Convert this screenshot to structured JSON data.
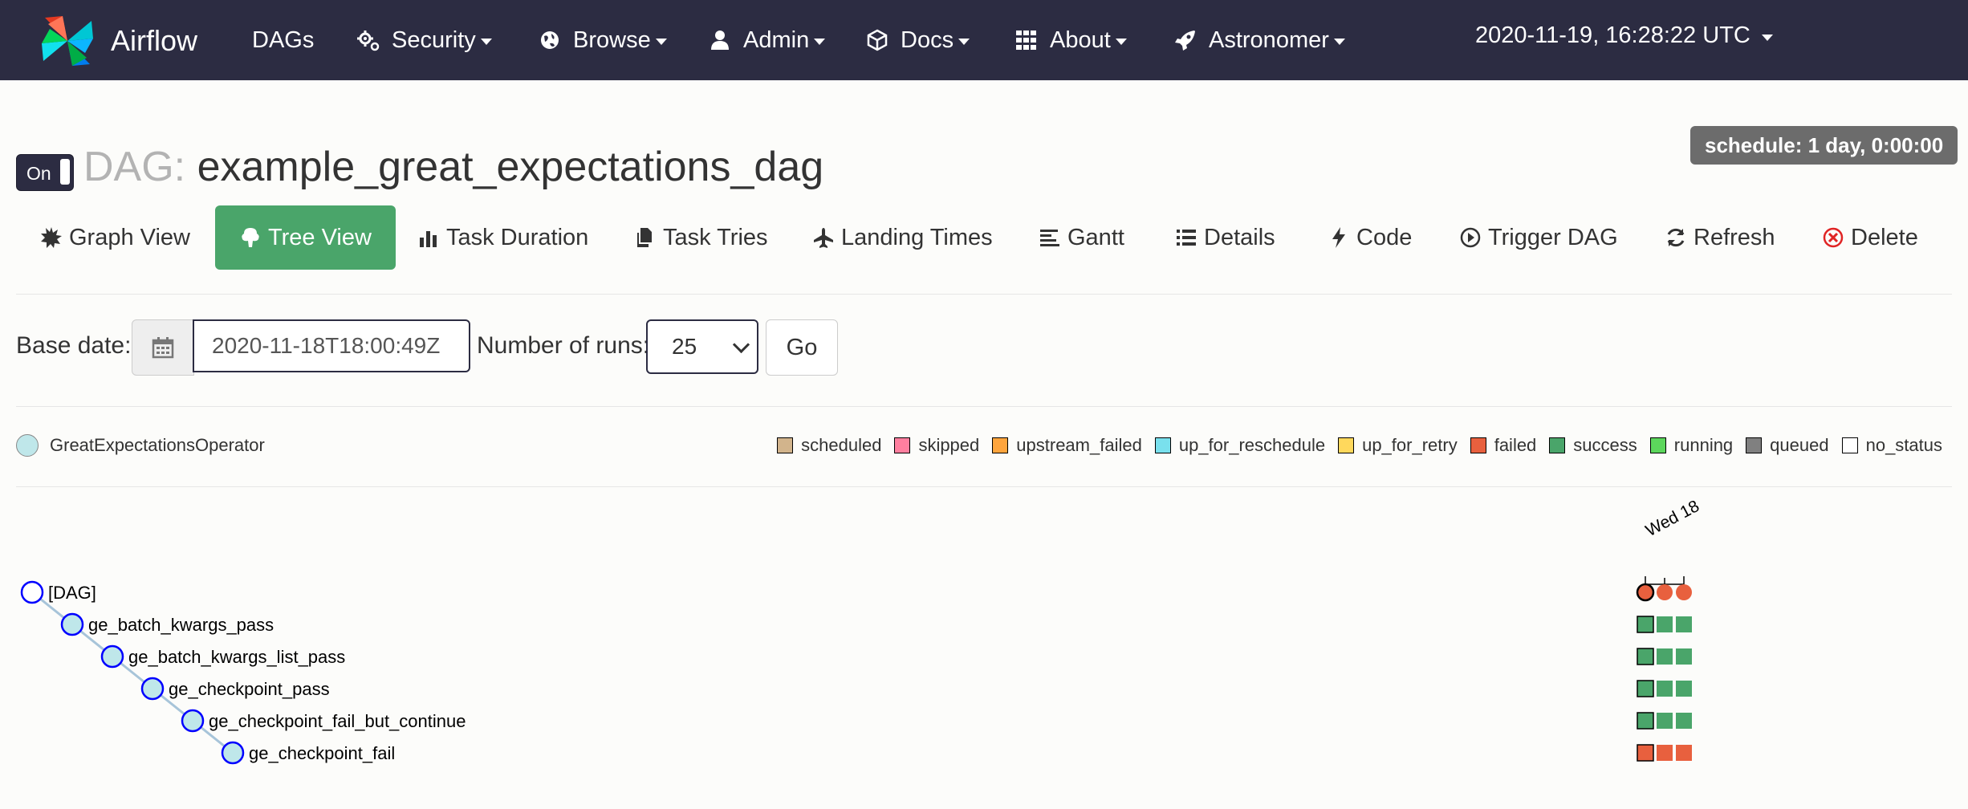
{
  "navbar": {
    "brand": "Airflow",
    "items": [
      {
        "label": "DAGs",
        "icon": ""
      },
      {
        "label": "Security",
        "icon": "gears-icon"
      },
      {
        "label": "Browse",
        "icon": "globe-icon"
      },
      {
        "label": "Admin",
        "icon": "user-icon"
      },
      {
        "label": "Docs",
        "icon": "cube-icon"
      },
      {
        "label": "About",
        "icon": "grid-icon"
      },
      {
        "label": "Astronomer",
        "icon": "rocket-icon"
      }
    ],
    "clock": "2020-11-19, 16:28:22 UTC"
  },
  "dag": {
    "toggle_label": "On",
    "title_prefix": "DAG:",
    "name": "example_great_expectations_dag",
    "schedule": "schedule: 1 day, 0:00:00"
  },
  "tabs": [
    {
      "label": "Graph View",
      "icon": "burst-icon"
    },
    {
      "label": "Tree View",
      "icon": "tree-icon",
      "active": true
    },
    {
      "label": "Task Duration",
      "icon": "bar-chart-icon"
    },
    {
      "label": "Task Tries",
      "icon": "files-icon"
    },
    {
      "label": "Landing Times",
      "icon": "plane-icon"
    },
    {
      "label": "Gantt",
      "icon": "align-left-icon"
    },
    {
      "label": "Details",
      "icon": "list-icon"
    },
    {
      "label": "Code",
      "icon": "bolt-icon"
    },
    {
      "label": "Trigger DAG",
      "icon": "play-circle-icon"
    },
    {
      "label": "Refresh",
      "icon": "refresh-icon"
    },
    {
      "label": "Delete",
      "icon": "times-circle-icon"
    }
  ],
  "filters": {
    "base_date_label": "Base date:",
    "base_date_value": "2020-11-18T18:00:49Z",
    "runs_label": "Number of runs:",
    "runs_value": "25",
    "go_label": "Go"
  },
  "operator_legend": {
    "name": "GreatExpectationsOperator",
    "color": "#bfe7ea"
  },
  "state_legend": [
    {
      "label": "scheduled",
      "color": "#d2b48c"
    },
    {
      "label": "skipped",
      "color": "#ff7f9f"
    },
    {
      "label": "upstream_failed",
      "color": "#ffa53d"
    },
    {
      "label": "up_for_reschedule",
      "color": "#79e0ed"
    },
    {
      "label": "up_for_retry",
      "color": "#ffd85c"
    },
    {
      "label": "failed",
      "color": "#e8603e"
    },
    {
      "label": "success",
      "color": "#4aa56a"
    },
    {
      "label": "running",
      "color": "#5cd65c"
    },
    {
      "label": "queued",
      "color": "#808080"
    },
    {
      "label": "no_status",
      "color": "#ffffff"
    }
  ],
  "tree": {
    "date_header": "Wed 18",
    "nodes": [
      {
        "label": "[DAG]",
        "runs": [
          "failed",
          "failed",
          "failed"
        ]
      },
      {
        "label": "ge_batch_kwargs_pass",
        "runs": [
          "success",
          "success",
          "success"
        ]
      },
      {
        "label": "ge_batch_kwargs_list_pass",
        "runs": [
          "success",
          "success",
          "success"
        ]
      },
      {
        "label": "ge_checkpoint_pass",
        "runs": [
          "success",
          "success",
          "success"
        ]
      },
      {
        "label": "ge_checkpoint_fail_but_continue",
        "runs": [
          "success",
          "success",
          "success"
        ]
      },
      {
        "label": "ge_checkpoint_fail",
        "runs": [
          "failed",
          "failed",
          "failed"
        ]
      }
    ]
  }
}
